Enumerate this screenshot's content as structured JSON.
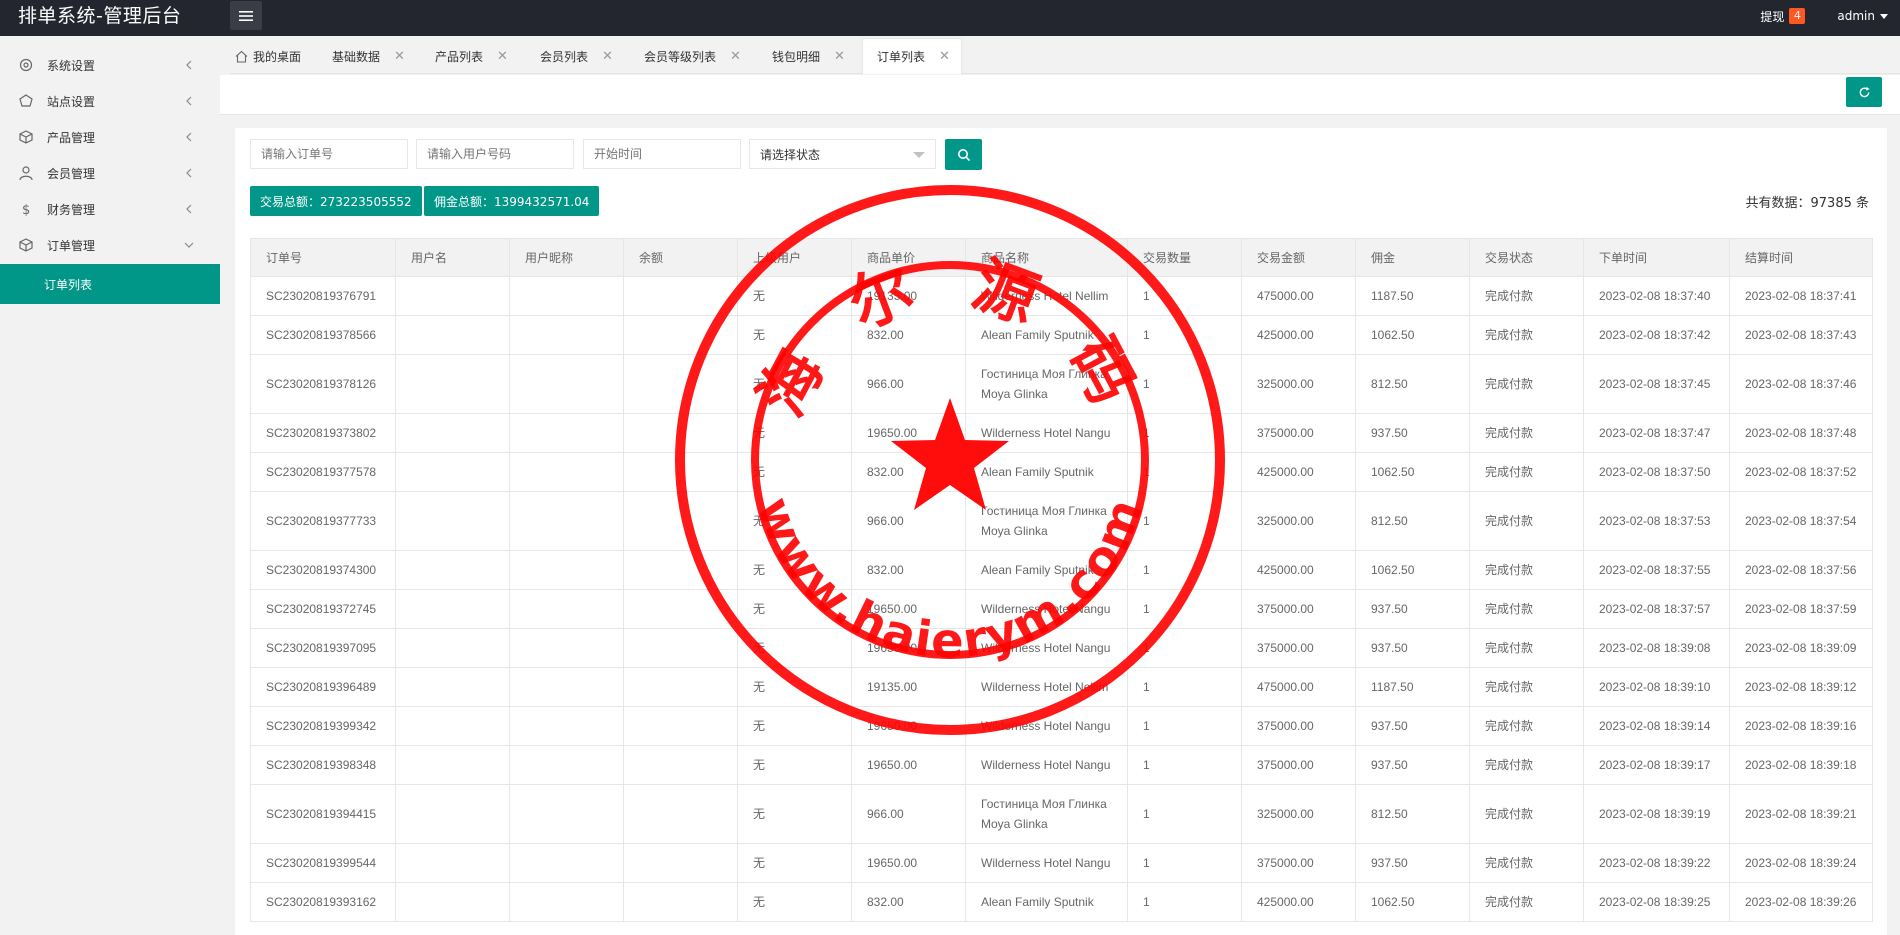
{
  "header": {
    "title": "排单系统-管理后台",
    "withdraw_label": "提现",
    "withdraw_badge": "4",
    "user_label": "admin"
  },
  "sidebar": {
    "items": [
      {
        "label": "系统设置",
        "icon": "gear-icon"
      },
      {
        "label": "站点设置",
        "icon": "site-icon"
      },
      {
        "label": "产品管理",
        "icon": "cube-icon"
      },
      {
        "label": "会员管理",
        "icon": "user-icon"
      },
      {
        "label": "财务管理",
        "icon": "dollar-icon"
      },
      {
        "label": "订单管理",
        "icon": "cube-icon"
      }
    ],
    "active_sub": "订单列表"
  },
  "tabs": [
    {
      "label": "我的桌面"
    },
    {
      "label": "基础数据"
    },
    {
      "label": "产品列表"
    },
    {
      "label": "会员列表"
    },
    {
      "label": "会员等级列表"
    },
    {
      "label": "钱包明细"
    },
    {
      "label": "订单列表",
      "active": true
    }
  ],
  "filters": {
    "order_no_placeholder": "请输入订单号",
    "user_no_placeholder": "请输入用户号码",
    "start_time_placeholder": "开始时间",
    "status_selected": "请选择状态"
  },
  "stats": {
    "trade_total": "交易总额：273223505552",
    "commission_total": "佣金总额：1399432571.04",
    "record_count": "共有数据：97385 条"
  },
  "table": {
    "columns": [
      "订单号",
      "用户名",
      "用户昵称",
      "余额",
      "上级用户",
      "商品单价",
      "商品名称",
      "交易数量",
      "交易金额",
      "佣金",
      "交易状态",
      "下单时间",
      "结算时间"
    ],
    "rows": [
      [
        "SC23020819376791",
        "",
        "",
        "",
        "无",
        "19135.00",
        "Wilderness Hotel Nellim",
        "1",
        "475000.00",
        "1187.50",
        "完成付款",
        "2023-02-08 18:37:40",
        "2023-02-08 18:37:41"
      ],
      [
        "SC23020819378566",
        "",
        "",
        "",
        "无",
        "832.00",
        "Alean Family Sputnik",
        "1",
        "425000.00",
        "1062.50",
        "完成付款",
        "2023-02-08 18:37:42",
        "2023-02-08 18:37:43"
      ],
      [
        "SC23020819378126",
        "",
        "",
        "",
        "无",
        "966.00",
        "Гостиница Моя Глинка Moya Glinka",
        "1",
        "325000.00",
        "812.50",
        "完成付款",
        "2023-02-08 18:37:45",
        "2023-02-08 18:37:46"
      ],
      [
        "SC23020819373802",
        "",
        "",
        "",
        "无",
        "19650.00",
        "Wilderness Hotel Nangu",
        "1",
        "375000.00",
        "937.50",
        "完成付款",
        "2023-02-08 18:37:47",
        "2023-02-08 18:37:48"
      ],
      [
        "SC23020819377578",
        "",
        "",
        "",
        "无",
        "832.00",
        "Alean Family Sputnik",
        "1",
        "425000.00",
        "1062.50",
        "完成付款",
        "2023-02-08 18:37:50",
        "2023-02-08 18:37:52"
      ],
      [
        "SC23020819377733",
        "",
        "",
        "",
        "无",
        "966.00",
        "Гостиница Моя Глинка Moya Glinka",
        "1",
        "325000.00",
        "812.50",
        "完成付款",
        "2023-02-08 18:37:53",
        "2023-02-08 18:37:54"
      ],
      [
        "SC23020819374300",
        "",
        "",
        "",
        "无",
        "832.00",
        "Alean Family Sputnik",
        "1",
        "425000.00",
        "1062.50",
        "完成付款",
        "2023-02-08 18:37:55",
        "2023-02-08 18:37:56"
      ],
      [
        "SC23020819372745",
        "",
        "",
        "",
        "无",
        "19650.00",
        "Wilderness Hotel Nangu",
        "1",
        "375000.00",
        "937.50",
        "完成付款",
        "2023-02-08 18:37:57",
        "2023-02-08 18:37:59"
      ],
      [
        "SC23020819397095",
        "",
        "",
        "",
        "无",
        "19650.00",
        "Wilderness Hotel Nangu",
        "1",
        "375000.00",
        "937.50",
        "完成付款",
        "2023-02-08 18:39:08",
        "2023-02-08 18:39:09"
      ],
      [
        "SC23020819396489",
        "",
        "",
        "",
        "无",
        "19135.00",
        "Wilderness Hotel Nellim",
        "1",
        "475000.00",
        "1187.50",
        "完成付款",
        "2023-02-08 18:39:10",
        "2023-02-08 18:39:12"
      ],
      [
        "SC23020819399342",
        "",
        "",
        "",
        "无",
        "19650.00",
        "Wilderness Hotel Nangu",
        "1",
        "375000.00",
        "937.50",
        "完成付款",
        "2023-02-08 18:39:14",
        "2023-02-08 18:39:16"
      ],
      [
        "SC23020819398348",
        "",
        "",
        "",
        "无",
        "19650.00",
        "Wilderness Hotel Nangu",
        "1",
        "375000.00",
        "937.50",
        "完成付款",
        "2023-02-08 18:39:17",
        "2023-02-08 18:39:18"
      ],
      [
        "SC23020819394415",
        "",
        "",
        "",
        "无",
        "966.00",
        "Гостиница Моя Глинка Moya Glinka",
        "1",
        "325000.00",
        "812.50",
        "完成付款",
        "2023-02-08 18:39:19",
        "2023-02-08 18:39:21"
      ],
      [
        "SC23020819399544",
        "",
        "",
        "",
        "无",
        "19650.00",
        "Wilderness Hotel Nangu",
        "1",
        "375000.00",
        "937.50",
        "完成付款",
        "2023-02-08 18:39:22",
        "2023-02-08 18:39:24"
      ],
      [
        "SC23020819393162",
        "",
        "",
        "",
        "无",
        "832.00",
        "Alean Family Sputnik",
        "1",
        "425000.00",
        "1062.50",
        "完成付款",
        "2023-02-08 18:39:25",
        "2023-02-08 18:39:26"
      ]
    ]
  },
  "watermark": {
    "top_text": "海 尔 源 码",
    "bottom_text": "www.haierym.com",
    "color": "#ff0000"
  },
  "colors": {
    "accent": "#009688",
    "header_bg": "#23262e",
    "badge": "#ff5722"
  }
}
